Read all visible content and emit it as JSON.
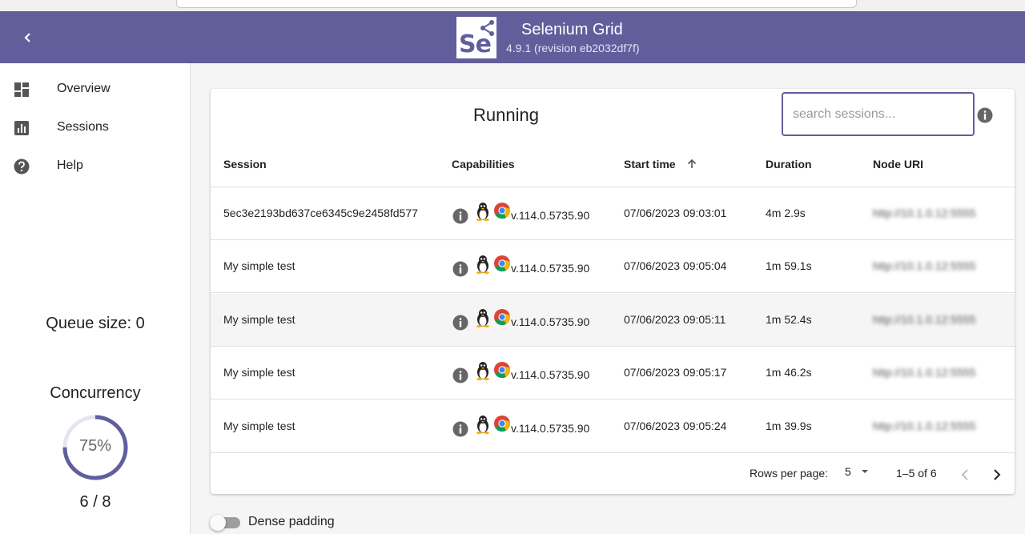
{
  "header": {
    "title": "Selenium Grid",
    "subtitle": "4.9.1 (revision eb2032df7f)",
    "logo_text": "Se",
    "color": "#615e9b"
  },
  "sidebar": {
    "items": [
      {
        "label": "Overview",
        "icon": "dashboard-icon"
      },
      {
        "label": "Sessions",
        "icon": "bar-chart-icon"
      },
      {
        "label": "Help",
        "icon": "help-icon"
      }
    ],
    "queue_label": "Queue size: 0",
    "concurrency_title": "Concurrency",
    "concurrency_percent": "75%",
    "concurrency_fraction": 0.75,
    "concurrency_count": "6 / 8"
  },
  "main": {
    "title": "Running",
    "search_placeholder": "search sessions...",
    "columns": [
      "Session",
      "Capabilities",
      "Start time",
      "Duration",
      "Node URI"
    ],
    "rows": [
      {
        "session": "5ec3e2193bd637ce6345c9e2458fd577",
        "version": "v.114.0.5735.90",
        "start": "07/06/2023 09:03:01",
        "duration": "4m 2.9s",
        "node": "http://10.1.0.12:5555"
      },
      {
        "session": "My simple test",
        "version": "v.114.0.5735.90",
        "start": "07/06/2023 09:05:04",
        "duration": "1m 59.1s",
        "node": "http://10.1.0.12:5555"
      },
      {
        "session": "My simple test",
        "version": "v.114.0.5735.90",
        "start": "07/06/2023 09:05:11",
        "duration": "1m 52.4s",
        "node": "http://10.1.0.12:5555"
      },
      {
        "session": "My simple test",
        "version": "v.114.0.5735.90",
        "start": "07/06/2023 09:05:17",
        "duration": "1m 46.2s",
        "node": "http://10.1.0.12:5555"
      },
      {
        "session": "My simple test",
        "version": "v.114.0.5735.90",
        "start": "07/06/2023 09:05:24",
        "duration": "1m 39.9s",
        "node": "http://10.1.0.12:5555"
      }
    ],
    "pagination": {
      "rows_per_page_label": "Rows per page:",
      "rows_per_page": "5",
      "range": "1–5 of 6"
    }
  },
  "dense_padding_label": "Dense padding"
}
